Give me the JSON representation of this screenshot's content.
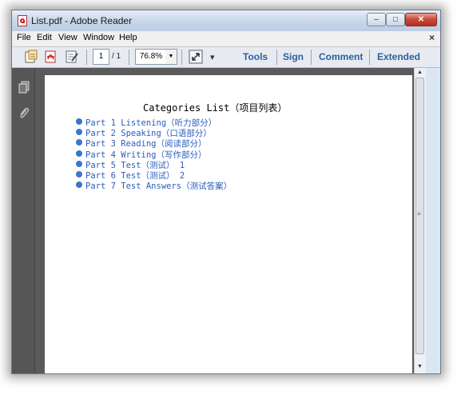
{
  "window": {
    "title": "List.pdf - Adobe Reader",
    "controls": {
      "minimize": "–",
      "maximize": "□",
      "close": "✕"
    }
  },
  "menubar": {
    "items": [
      "File",
      "Edit",
      "View",
      "Window",
      "Help"
    ],
    "close_symbol": "×"
  },
  "toolbar": {
    "page_number": "1",
    "page_count": "/ 1",
    "zoom": "76.8%",
    "zoom_dropdown": "▼",
    "more_tools": "▾",
    "links": [
      "Tools",
      "Sign",
      "Comment",
      "Extended"
    ]
  },
  "sidebar_icons": [
    "pages-icon",
    "attachment-icon"
  ],
  "scrollbar": {
    "up": "▲",
    "down": "▼",
    "grip": "≡"
  },
  "document": {
    "title": "Categories List（项目列表）",
    "items": [
      "Part 1 Listening（听力部分）",
      "Part 2 Speaking（口语部分）",
      "Part 3 Reading（阅读部分）",
      "Part 4 Writing（写作部分）",
      "Part 5 Test（测试） 1",
      "Part 6 Test（测试） 2",
      "Part 7 Test Answers（测试答案）"
    ]
  },
  "colors": {
    "link_blue": "#2b5dbb",
    "bullet_blue": "#3a77c8",
    "toolbar_link": "#2c5f9e",
    "close_red": "#c9483a"
  }
}
